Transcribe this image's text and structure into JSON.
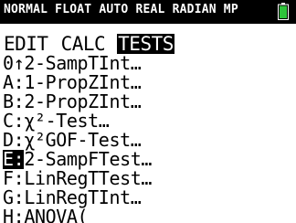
{
  "status_bar": {
    "text": "NORMAL FLOAT AUTO REAL RADIAN MP",
    "bg_color": "#000000",
    "fg_color": "#ffffff",
    "battery_color": "#2ec23a",
    "battery_icon": "battery-full-icon"
  },
  "menu": {
    "tabs": [
      {
        "label": "EDIT",
        "selected": false
      },
      {
        "label": "CALC",
        "selected": false
      },
      {
        "label": "TESTS",
        "selected": true
      }
    ],
    "items": [
      {
        "key": "0",
        "sep": "↑",
        "label": "2-SampTInt…",
        "selected": false
      },
      {
        "key": "A",
        "sep": ":",
        "label": "1-PropZInt…",
        "selected": false
      },
      {
        "key": "B",
        "sep": ":",
        "label": "2-PropZInt…",
        "selected": false
      },
      {
        "key": "C",
        "sep": ":",
        "label": "χ²-Test…",
        "selected": false
      },
      {
        "key": "D",
        "sep": ":",
        "label": "χ²GOF-Test…",
        "selected": false
      },
      {
        "key": "E",
        "sep": ":",
        "label": "2-SampFTest…",
        "selected": true
      },
      {
        "key": "F",
        "sep": ":",
        "label": "LinRegTTest…",
        "selected": false
      },
      {
        "key": "G",
        "sep": ":",
        "label": "LinRegTInt…",
        "selected": false
      },
      {
        "key": "H",
        "sep": ":",
        "label": "ANOVA(",
        "selected": false
      }
    ]
  }
}
